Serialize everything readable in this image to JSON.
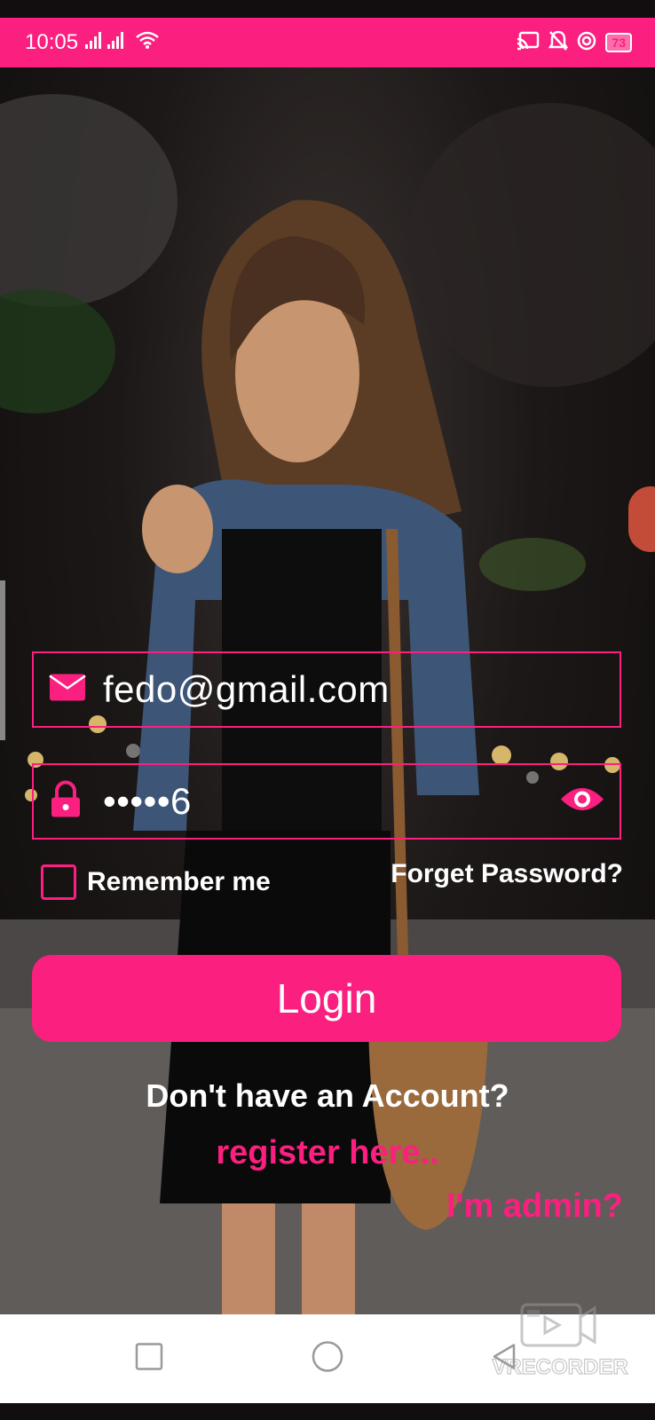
{
  "status_bar": {
    "time": "10:05",
    "battery": "73"
  },
  "login": {
    "email_value": "fedo@gmail.com",
    "password_value": "•••••6",
    "remember_label": "Remember me",
    "forget_label": "Forget Password?",
    "button_label": "Login",
    "no_account_text": "Don't have an Account?",
    "register_link": "register here..",
    "admin_link": "I'm admin?"
  },
  "watermark": {
    "text": "VRECORDER"
  },
  "colors": {
    "accent": "#fb1f7f",
    "text": "#ffffff"
  },
  "icons": [
    "signal-icon",
    "wifi-icon",
    "cast-icon",
    "bell-off-icon",
    "at-icon",
    "battery-icon",
    "email-icon",
    "lock-icon",
    "eye-icon",
    "nav-recents-icon",
    "nav-home-icon",
    "nav-back-icon"
  ]
}
